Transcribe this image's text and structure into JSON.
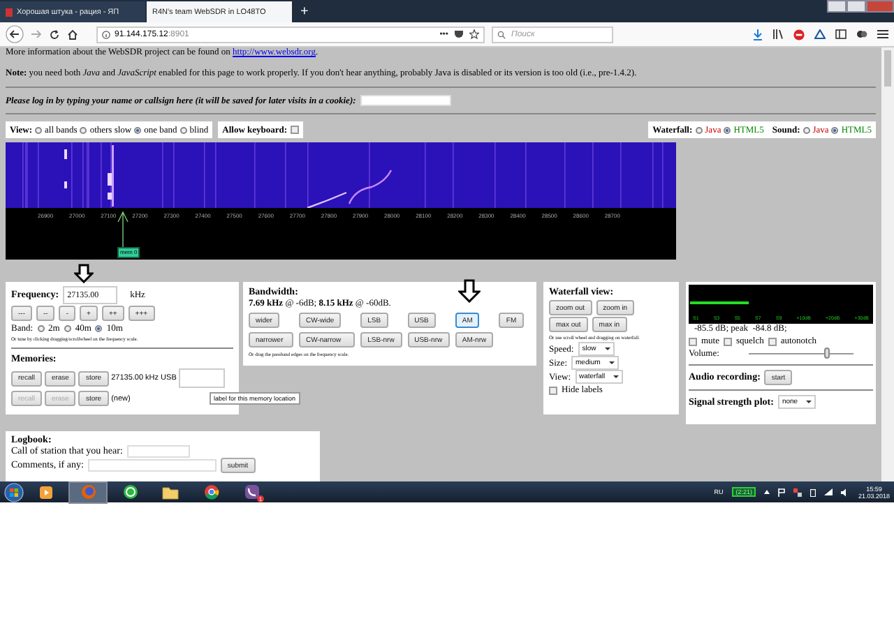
{
  "browser": {
    "tabs": [
      {
        "title": "Хорошая штука - рация - ЯП",
        "selected": false
      },
      {
        "title": "R4N's team WebSDR in LO48TO",
        "selected": true
      }
    ],
    "new_tab": "+",
    "url_host": "91.144.175.12",
    "url_port": ":8901",
    "more": "•••",
    "search": {
      "placeholder": "Поиск"
    }
  },
  "page": {
    "info": {
      "before": "More information about the WebSDR project can be found on ",
      "link": "http://www.websdr.org",
      "after": "."
    },
    "note": "**Note:** you need both *Java* and *JavaScript* enabled for this page to work properly. If you don't hear anything, probably Java is disabled or its version is too old (i.e., pre-1.4.2).",
    "login": {
      "label": "Please log in by typing your name or callsign here (it will be saved for later visits in a cookie):"
    },
    "view": {
      "label": "View:",
      "options": [
        {
          "label": "all bands",
          "selected": false
        },
        {
          "label": "others slow",
          "selected": false
        },
        {
          "label": "one band",
          "selected": true
        },
        {
          "label": "blind",
          "selected": false
        }
      ]
    },
    "allow_keyboard": {
      "label": "Allow keyboard:",
      "checked": false
    },
    "engines": [
      {
        "label": "Waterfall:",
        "options": [
          {
            "label": "Java",
            "selected": false
          },
          {
            "label": "HTML5",
            "selected": true
          }
        ]
      },
      {
        "label": "Sound:",
        "options": [
          {
            "label": "Java",
            "selected": false
          },
          {
            "label": "HTML5",
            "selected": true
          }
        ]
      }
    ],
    "waterfall": {
      "scale": [
        "26900",
        "27000",
        "27100",
        "27200",
        "27300",
        "27400",
        "27500",
        "27600",
        "27700",
        "27800",
        "27900",
        "28000",
        "28100",
        "28200",
        "28300",
        "28400",
        "28500",
        "28600",
        "28700"
      ],
      "marker": "mem 0"
    },
    "frequency": {
      "label": "Frequency:",
      "value": "27135.00",
      "unit": "kHz",
      "steps": [
        "---",
        "--",
        "-",
        "+",
        "++",
        "+++"
      ],
      "band_label": "Band:",
      "bands": [
        {
          "label": "2m",
          "selected": false
        },
        {
          "label": "40m",
          "selected": false
        },
        {
          "label": "10m",
          "selected": true
        }
      ],
      "hint": "Or tune by clicking dragging/scrollwheel on the frequency scale."
    },
    "memories": {
      "label": "Memories:",
      "rows": [
        {
          "kind": "saved",
          "buttons": [
            {
              "label": "recall",
              "disabled": false
            },
            {
              "label": "erase",
              "disabled": false
            },
            {
              "label": "store",
              "disabled": false
            }
          ],
          "text": "27135.00 kHz USB"
        },
        {
          "kind": "new",
          "buttons": [
            {
              "label": "recall",
              "disabled": true
            },
            {
              "label": "erase",
              "disabled": true
            },
            {
              "label": "store",
              "disabled": false
            }
          ],
          "text": "(new)"
        }
      ],
      "tooltip": "label for this memory location"
    },
    "bandwidth": {
      "label": "Bandwidth:",
      "reading": "**7.69 kHz** @ -6dB; **8.15 kHz** @ -60dB.",
      "rows": [
        [
          {
            "label": "wider",
            "selected": false
          },
          {
            "label": "CW-wide",
            "selected": false
          },
          {
            "label": "LSB",
            "selected": false
          },
          {
            "label": "USB",
            "selected": false
          },
          {
            "label": "AM",
            "selected": true
          },
          {
            "label": "FM",
            "selected": false
          }
        ],
        [
          {
            "label": "narrower",
            "selected": false
          },
          {
            "label": "CW-narrow",
            "selected": false
          },
          {
            "label": "LSB-nrw",
            "selected": false
          },
          {
            "label": "USB-nrw",
            "selected": false
          },
          {
            "label": "AM-nrw",
            "selected": false
          }
        ]
      ],
      "hint": "Or drag the passband edges on the frequency scale."
    },
    "waterfall_view": {
      "label": "Waterfall view:",
      "buttons": [
        "zoom out",
        "zoom in",
        "max out",
        "max in"
      ],
      "hint": "Or use scroll wheel and dragging on waterfall.",
      "selects": [
        {
          "label": "Speed:",
          "value": "slow"
        },
        {
          "label": "Size:",
          "value": "medium"
        },
        {
          "label": "View:",
          "value": "waterfall"
        }
      ],
      "hide_labels": {
        "label": "Hide labels",
        "checked": false
      }
    },
    "audio": {
      "meter": {
        "level": 0.32,
        "scale": [
          "S1",
          "S3",
          "S5",
          "S7",
          "S9",
          "+10dB",
          "+20dB",
          "+30dB"
        ]
      },
      "reading": "-85.5 dB; peak  -84.8 dB;",
      "toggles": [
        {
          "label": "mute",
          "checked": false
        },
        {
          "label": "squelch",
          "checked": false
        },
        {
          "label": "autonotch",
          "checked": false
        }
      ],
      "volume": {
        "label": "Volume:",
        "level": 0.75
      },
      "recording": {
        "label": "Audio recording:",
        "button": "start"
      },
      "plot": {
        "label": "Signal strength plot:",
        "value": "none"
      }
    },
    "logbook": {
      "label": "Logbook:",
      "call_label": "Call of station that you hear:",
      "comments_label": "Comments, if any:",
      "submit": "submit"
    }
  },
  "taskbar": {
    "apps": [
      {
        "kind": "media",
        "selected": false
      },
      {
        "kind": "firefox",
        "selected": true
      },
      {
        "kind": "whatsapp",
        "selected": false
      },
      {
        "kind": "folder",
        "selected": false
      },
      {
        "kind": "chrome",
        "selected": false
      },
      {
        "kind": "viber",
        "selected": false,
        "badge": "1"
      }
    ],
    "language": "RU",
    "battery": "(2:21)",
    "time": "15:59",
    "date": "21.03.2018"
  }
}
